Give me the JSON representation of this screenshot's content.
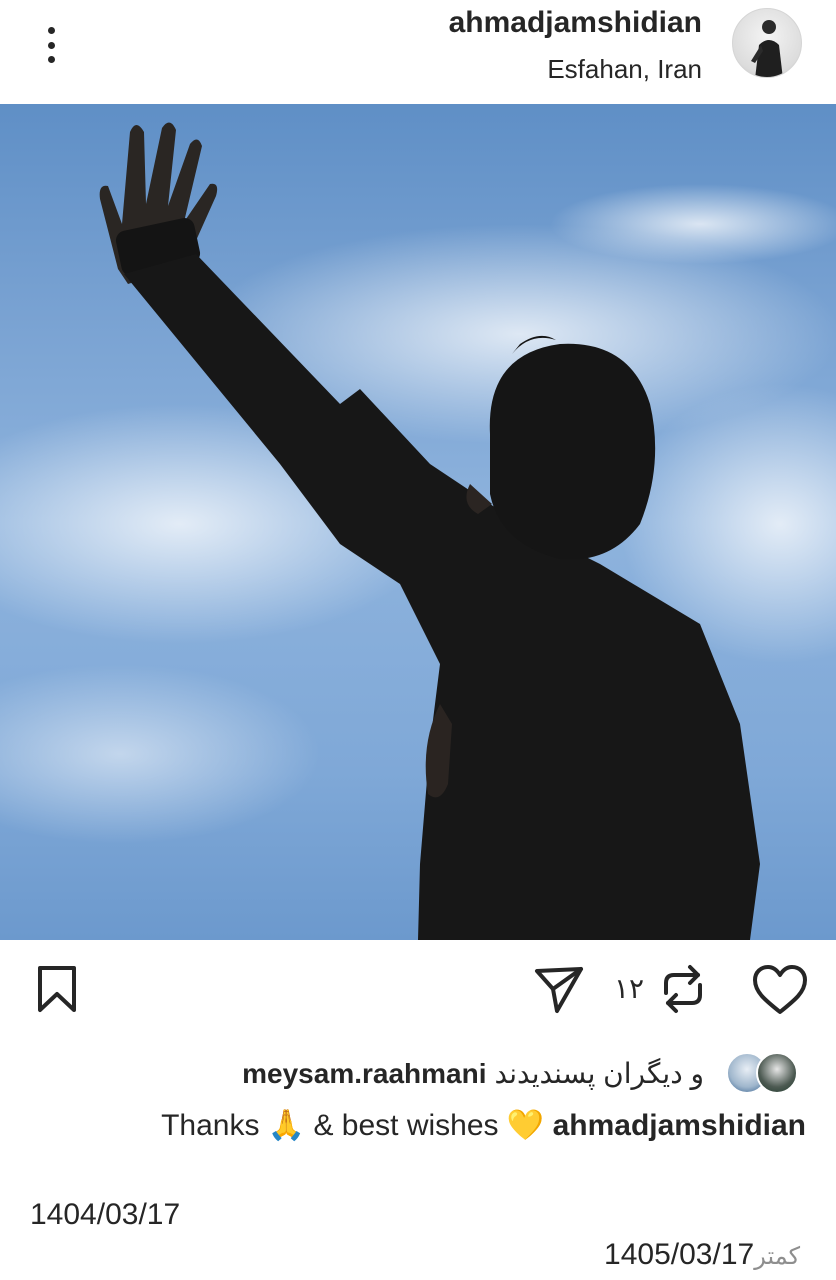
{
  "post": {
    "username": "ahmadjamshidian",
    "location": "Esfahan, Iran"
  },
  "actions": {
    "repost_count": "۱۲"
  },
  "likes": {
    "user": "meysam.raahmani",
    "others_text": "و دیگران پسندیدند"
  },
  "caption": {
    "username": "ahmadjamshidian",
    "text": "Thanks 🙏 & best wishes 💛"
  },
  "dates": {
    "original": "1404/03/17",
    "current": "1405/03/17",
    "less_label": "کمتر"
  },
  "icons": {
    "more": "more-vertical-icon",
    "bookmark": "bookmark-icon",
    "share": "send-icon",
    "repost": "repost-icon",
    "like": "heart-icon"
  }
}
